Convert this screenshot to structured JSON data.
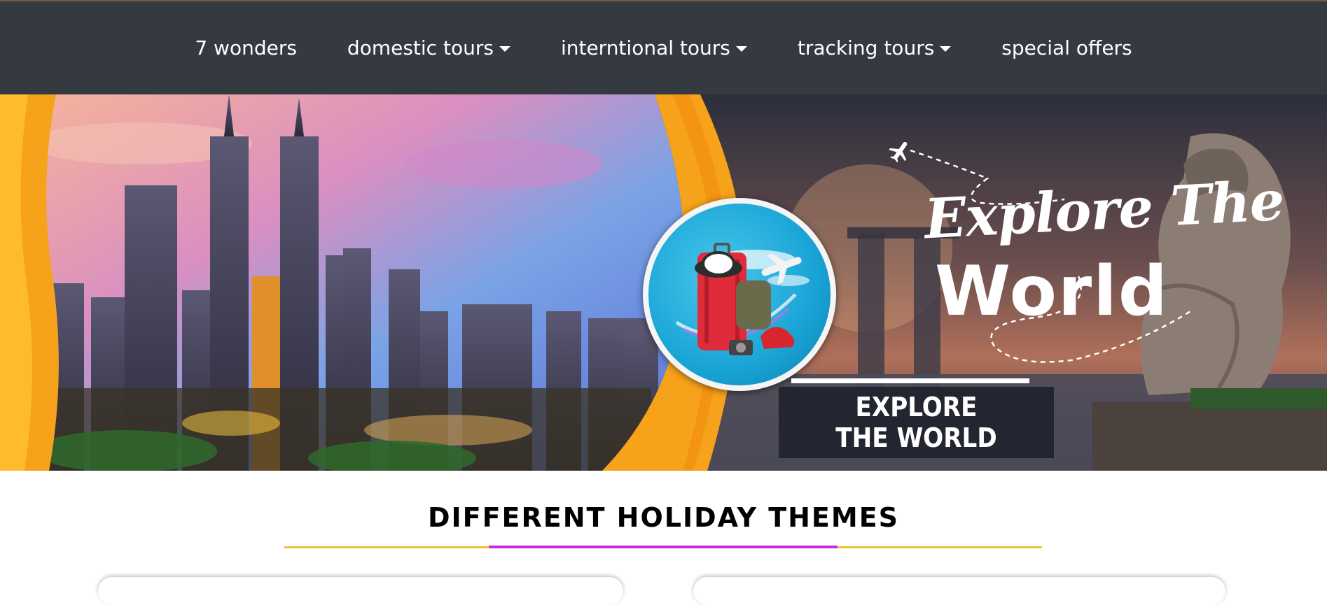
{
  "nav": {
    "items": [
      {
        "label": "7 wonders",
        "dropdown": false
      },
      {
        "label": "domestic tours",
        "dropdown": true
      },
      {
        "label": "interntional tours",
        "dropdown": true
      },
      {
        "label": "tracking tours",
        "dropdown": true
      },
      {
        "label": "special offers",
        "dropdown": false
      }
    ]
  },
  "banner": {
    "headline_script": "Explore The",
    "headline_bold": "World",
    "cta_label": "EXPLORE THE WORLD",
    "icons": [
      "plane-icon",
      "suitcase-icon",
      "camera-icon",
      "sneaker-icon"
    ]
  },
  "section": {
    "title": "DIFFERENT HOLIDAY THEMES"
  },
  "colors": {
    "nav_bg": "#343a40",
    "accent_orange": "#f7a21b",
    "underline_gold": "#f1c232",
    "underline_magenta": "#c72bd6",
    "cta_bg": "#232630"
  }
}
